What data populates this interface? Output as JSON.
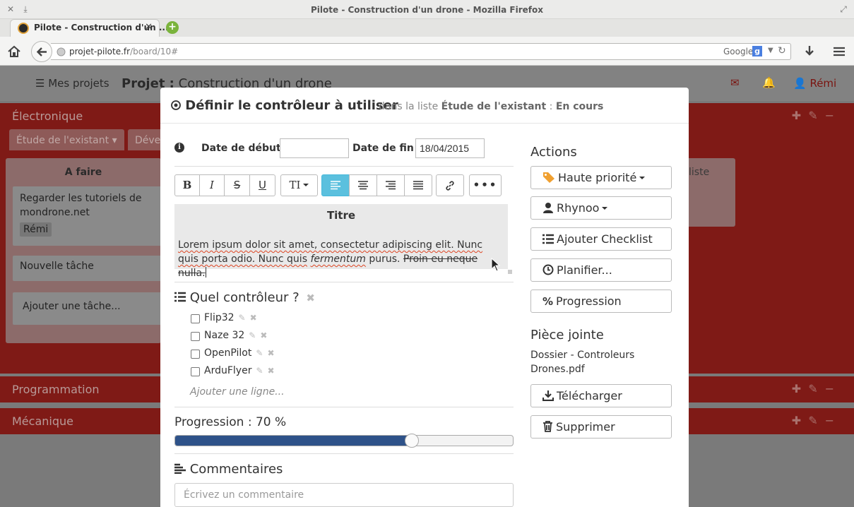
{
  "browser": {
    "window_title": "Pilote - Construction d'un drone - Mozilla Firefox",
    "tab_label": "Pilote - Construction d'un ...",
    "url_host": "projet-pilote.fr",
    "url_path": "/board/10#",
    "search_engine": "Google"
  },
  "app": {
    "my_projects": "Mes projets",
    "project_prefix": "Projet :",
    "project_name": "Construction d'un drone",
    "user": "Rémi"
  },
  "board": {
    "sections": [
      {
        "title": "Électronique"
      },
      {
        "title": "Programmation"
      },
      {
        "title": "Mécanique"
      }
    ],
    "tabs": [
      "Étude de l'existant",
      "Dével"
    ],
    "column_title": "A faire",
    "cards": [
      {
        "text": "Regarder les tutoriels de mondrone.net",
        "tag": "Rémi"
      },
      {
        "text": "Nouvelle tâche"
      }
    ],
    "add_task": "Ajouter une tâche...",
    "partial_list_text": "liste"
  },
  "modal": {
    "title": "Définir le contrôleur à utiliser",
    "context_prefix": "dans la liste",
    "list_name": "Étude de l'existant",
    "separator": ":",
    "status": "En cours",
    "start_label": "Date de début :",
    "start_value": "",
    "end_label": "Date de fin :",
    "end_value": "18/04/2015",
    "editor": {
      "heading": "Titre",
      "text_normal_1": "Lorem ipsum dolor sit amet, consectetur adipiscing elit. Nunc quis porta odio. Nunc quis",
      "text_italic": "fermentum",
      "text_normal_2": "purus.",
      "text_strike": "Proin eu neque nulla."
    },
    "checklist": {
      "title": "Quel contrôleur ?",
      "items": [
        {
          "label": "Flip32",
          "checked": false
        },
        {
          "label": "Naze 32",
          "checked": false
        },
        {
          "label": "OpenPilot",
          "checked": false
        },
        {
          "label": "ArduFlyer",
          "checked": false
        }
      ],
      "add_line": "Ajouter une ligne..."
    },
    "progress": {
      "label": "Progression : 70 %",
      "value": 70
    },
    "comments": {
      "title": "Commentaires",
      "placeholder": "Écrivez un commentaire"
    },
    "actions": {
      "title": "Actions",
      "buttons": [
        "Haute priorité",
        "Rhynoo",
        "Ajouter Checklist",
        "Planifier...",
        "Progression"
      ]
    },
    "attachment": {
      "title": "Pièce jointe",
      "file": "Dossier - Controleurs Drones.pdf",
      "download": "Télécharger",
      "delete": "Supprimer"
    }
  },
  "colors": {
    "accent": "#5bc0de",
    "progress": "#2e5289",
    "board_bg": "#7f1a16"
  }
}
